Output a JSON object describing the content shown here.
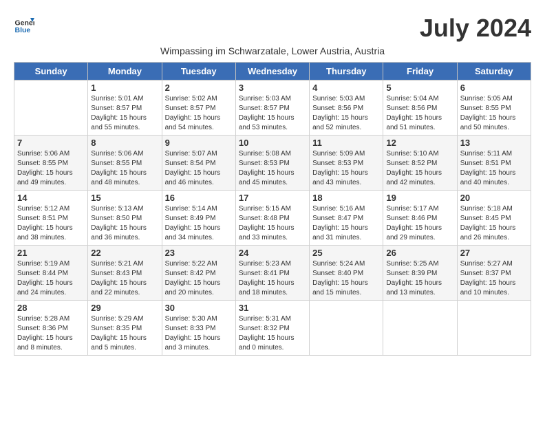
{
  "logo": {
    "line1": "General",
    "line2": "Blue"
  },
  "title": "July 2024",
  "subtitle": "Wimpassing im Schwarzatale, Lower Austria, Austria",
  "headers": [
    "Sunday",
    "Monday",
    "Tuesday",
    "Wednesday",
    "Thursday",
    "Friday",
    "Saturday"
  ],
  "weeks": [
    [
      {
        "day": "",
        "info": ""
      },
      {
        "day": "1",
        "info": "Sunrise: 5:01 AM\nSunset: 8:57 PM\nDaylight: 15 hours\nand 55 minutes."
      },
      {
        "day": "2",
        "info": "Sunrise: 5:02 AM\nSunset: 8:57 PM\nDaylight: 15 hours\nand 54 minutes."
      },
      {
        "day": "3",
        "info": "Sunrise: 5:03 AM\nSunset: 8:57 PM\nDaylight: 15 hours\nand 53 minutes."
      },
      {
        "day": "4",
        "info": "Sunrise: 5:03 AM\nSunset: 8:56 PM\nDaylight: 15 hours\nand 52 minutes."
      },
      {
        "day": "5",
        "info": "Sunrise: 5:04 AM\nSunset: 8:56 PM\nDaylight: 15 hours\nand 51 minutes."
      },
      {
        "day": "6",
        "info": "Sunrise: 5:05 AM\nSunset: 8:55 PM\nDaylight: 15 hours\nand 50 minutes."
      }
    ],
    [
      {
        "day": "7",
        "info": "Sunrise: 5:06 AM\nSunset: 8:55 PM\nDaylight: 15 hours\nand 49 minutes."
      },
      {
        "day": "8",
        "info": "Sunrise: 5:06 AM\nSunset: 8:55 PM\nDaylight: 15 hours\nand 48 minutes."
      },
      {
        "day": "9",
        "info": "Sunrise: 5:07 AM\nSunset: 8:54 PM\nDaylight: 15 hours\nand 46 minutes."
      },
      {
        "day": "10",
        "info": "Sunrise: 5:08 AM\nSunset: 8:53 PM\nDaylight: 15 hours\nand 45 minutes."
      },
      {
        "day": "11",
        "info": "Sunrise: 5:09 AM\nSunset: 8:53 PM\nDaylight: 15 hours\nand 43 minutes."
      },
      {
        "day": "12",
        "info": "Sunrise: 5:10 AM\nSunset: 8:52 PM\nDaylight: 15 hours\nand 42 minutes."
      },
      {
        "day": "13",
        "info": "Sunrise: 5:11 AM\nSunset: 8:51 PM\nDaylight: 15 hours\nand 40 minutes."
      }
    ],
    [
      {
        "day": "14",
        "info": "Sunrise: 5:12 AM\nSunset: 8:51 PM\nDaylight: 15 hours\nand 38 minutes."
      },
      {
        "day": "15",
        "info": "Sunrise: 5:13 AM\nSunset: 8:50 PM\nDaylight: 15 hours\nand 36 minutes."
      },
      {
        "day": "16",
        "info": "Sunrise: 5:14 AM\nSunset: 8:49 PM\nDaylight: 15 hours\nand 34 minutes."
      },
      {
        "day": "17",
        "info": "Sunrise: 5:15 AM\nSunset: 8:48 PM\nDaylight: 15 hours\nand 33 minutes."
      },
      {
        "day": "18",
        "info": "Sunrise: 5:16 AM\nSunset: 8:47 PM\nDaylight: 15 hours\nand 31 minutes."
      },
      {
        "day": "19",
        "info": "Sunrise: 5:17 AM\nSunset: 8:46 PM\nDaylight: 15 hours\nand 29 minutes."
      },
      {
        "day": "20",
        "info": "Sunrise: 5:18 AM\nSunset: 8:45 PM\nDaylight: 15 hours\nand 26 minutes."
      }
    ],
    [
      {
        "day": "21",
        "info": "Sunrise: 5:19 AM\nSunset: 8:44 PM\nDaylight: 15 hours\nand 24 minutes."
      },
      {
        "day": "22",
        "info": "Sunrise: 5:21 AM\nSunset: 8:43 PM\nDaylight: 15 hours\nand 22 minutes."
      },
      {
        "day": "23",
        "info": "Sunrise: 5:22 AM\nSunset: 8:42 PM\nDaylight: 15 hours\nand 20 minutes."
      },
      {
        "day": "24",
        "info": "Sunrise: 5:23 AM\nSunset: 8:41 PM\nDaylight: 15 hours\nand 18 minutes."
      },
      {
        "day": "25",
        "info": "Sunrise: 5:24 AM\nSunset: 8:40 PM\nDaylight: 15 hours\nand 15 minutes."
      },
      {
        "day": "26",
        "info": "Sunrise: 5:25 AM\nSunset: 8:39 PM\nDaylight: 15 hours\nand 13 minutes."
      },
      {
        "day": "27",
        "info": "Sunrise: 5:27 AM\nSunset: 8:37 PM\nDaylight: 15 hours\nand 10 minutes."
      }
    ],
    [
      {
        "day": "28",
        "info": "Sunrise: 5:28 AM\nSunset: 8:36 PM\nDaylight: 15 hours\nand 8 minutes."
      },
      {
        "day": "29",
        "info": "Sunrise: 5:29 AM\nSunset: 8:35 PM\nDaylight: 15 hours\nand 5 minutes."
      },
      {
        "day": "30",
        "info": "Sunrise: 5:30 AM\nSunset: 8:33 PM\nDaylight: 15 hours\nand 3 minutes."
      },
      {
        "day": "31",
        "info": "Sunrise: 5:31 AM\nSunset: 8:32 PM\nDaylight: 15 hours\nand 0 minutes."
      },
      {
        "day": "",
        "info": ""
      },
      {
        "day": "",
        "info": ""
      },
      {
        "day": "",
        "info": ""
      }
    ]
  ]
}
